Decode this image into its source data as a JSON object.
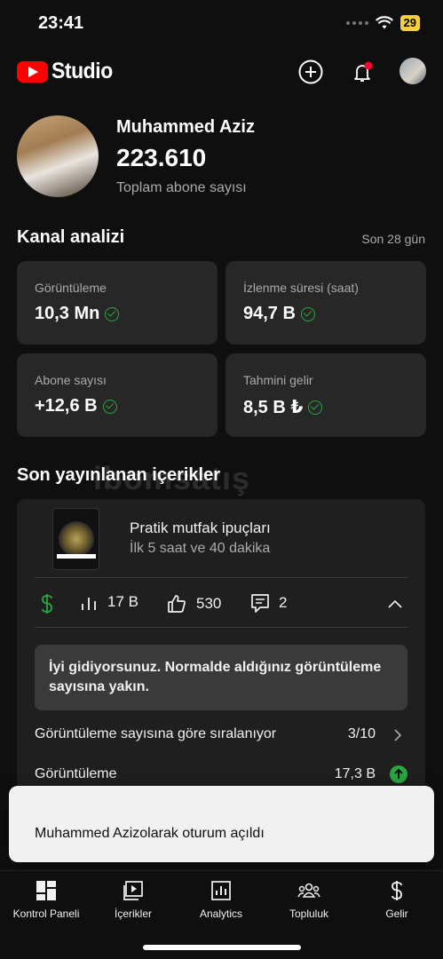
{
  "status_bar": {
    "time": "23:41",
    "battery": "29"
  },
  "header": {
    "logo_text": "Studio"
  },
  "profile": {
    "name": "Muhammed Aziz",
    "subscribers": "223.610",
    "subscribers_label": "Toplam abone sayısı"
  },
  "analytics": {
    "title": "Kanal analizi",
    "range": "Son 28 gün",
    "cards": [
      {
        "label": "Görüntüleme",
        "value": "10,3 Mn"
      },
      {
        "label": "İzlenme süresi (saat)",
        "value": "94,7 B"
      },
      {
        "label": "Abone sayısı",
        "value": "+12,6 B"
      },
      {
        "label": "Tahmini gelir",
        "value": "8,5 B ₺"
      }
    ]
  },
  "watermark": "ibomsatış",
  "recent": {
    "title": "Son yayınlanan içerikler",
    "video_title": "Pratik mutfak ipuçları",
    "video_age": "İlk 5 saat ve 40 dakika",
    "views": "17 B",
    "likes": "530",
    "comments": "2",
    "insight": "İyi gidiyorsunuz. Normalde aldığınız görüntüleme sayısına yakın.",
    "rank_label": "Görüntüleme sayısına göre sıralanıyor",
    "rank_value": "3/10",
    "views_label": "Görüntüleme",
    "views_value": "17,3 B"
  },
  "toast": {
    "text": "Muhammed Azizolarak oturum açıldı"
  },
  "nav": [
    {
      "label": "Kontrol Paneli",
      "icon": "dashboard-icon"
    },
    {
      "label": "İçerikler",
      "icon": "content-icon"
    },
    {
      "label": "Analytics",
      "icon": "analytics-icon"
    },
    {
      "label": "Topluluk",
      "icon": "community-icon"
    },
    {
      "label": "Gelir",
      "icon": "dollar-icon"
    }
  ],
  "colors": {
    "accent_green": "#2ba640",
    "brand_red": "#ff0000",
    "notification_dot": "#ff0033"
  }
}
